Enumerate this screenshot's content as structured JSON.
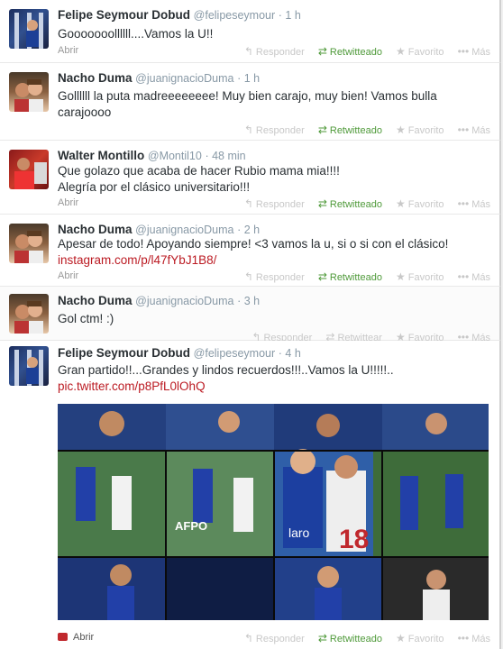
{
  "tweets": [
    {
      "name": "Felipe Seymour Dobud",
      "handle": "@felipeseymour",
      "time": "· 1 h",
      "text_lines": [
        "Gooooooollllll....Vamos la U!!"
      ],
      "open_label": "Abrir",
      "actions": {
        "reply": "Responder",
        "retweet": "Retwitteado",
        "favorite": "Favorito",
        "more": "Más"
      }
    },
    {
      "name": "Nacho Duma",
      "handle": "@juanignacioDuma",
      "time": "· 1 h",
      "text_lines": [
        "Gollllll la puta madreeeeeeee! Muy bien carajo, muy bien! Vamos bulla",
        "carajoooo"
      ],
      "open_label": "Abrir",
      "actions": {
        "reply": "Responder",
        "retweet": "Retwitteado",
        "favorite": "Favorito",
        "more": "Más"
      }
    },
    {
      "name": "Walter Montillo",
      "handle": "@Montil10",
      "time": "· 48 min",
      "text_lines": [
        "Que golazo que acaba de hacer Rubio mama mia!!!!",
        "Alegría por el clásico universitario!!!"
      ],
      "open_label": "Abrir",
      "actions": {
        "reply": "Responder",
        "retweet": "Retwitteado",
        "favorite": "Favorito",
        "more": "Más"
      }
    },
    {
      "name": "Nacho Duma",
      "handle": "@juanignacioDuma",
      "time": "· 2 h",
      "text_lines": [
        "Apesar de todo! Apoyando siempre!  <3 vamos la u, si o si con el clásico!"
      ],
      "link": "instagram.com/p/l47fYbJ1B8/",
      "open_label": "Abrir",
      "actions": {
        "reply": "Responder",
        "retweet": "Retwitteado",
        "favorite": "Favorito",
        "more": "Más"
      }
    },
    {
      "name": "Nacho Duma",
      "handle": "@juanignacioDuma",
      "time": "· 3 h",
      "text_lines": [
        "Gol ctm! :)"
      ],
      "actions": {
        "reply": "Responder",
        "retweet": "Retwittear",
        "favorite": "Favorito",
        "more": "Más"
      }
    },
    {
      "name": "Felipe Seymour Dobud",
      "handle": "@felipeseymour",
      "time": "· 4 h",
      "text_lines": [
        "Gran partido!!...Grandes y lindos recuerdos!!!..Vamos la U!!!!!.."
      ],
      "link": "pic.twitter.com/p8PfL0lOhQ",
      "open_label": "Abrir",
      "actions": {
        "reply": "Responder",
        "retweet": "Retwitteado",
        "favorite": "Favorito",
        "more": "Más"
      }
    }
  ],
  "photo_text": {
    "jersey_number": "18",
    "sponsor": "laro",
    "ad_text": "AFPO"
  },
  "colors": {
    "link": "#bb1a22",
    "retweeted": "#4f9a3a",
    "inactive": "#c8c8c8",
    "name": "#292f33",
    "meta": "#8899a6"
  },
  "icons": {
    "reply": "reply-arrow-icon",
    "retweet": "retweet-icon",
    "favorite": "star-icon",
    "more": "ellipsis-icon",
    "open_media": "photo-icon"
  }
}
